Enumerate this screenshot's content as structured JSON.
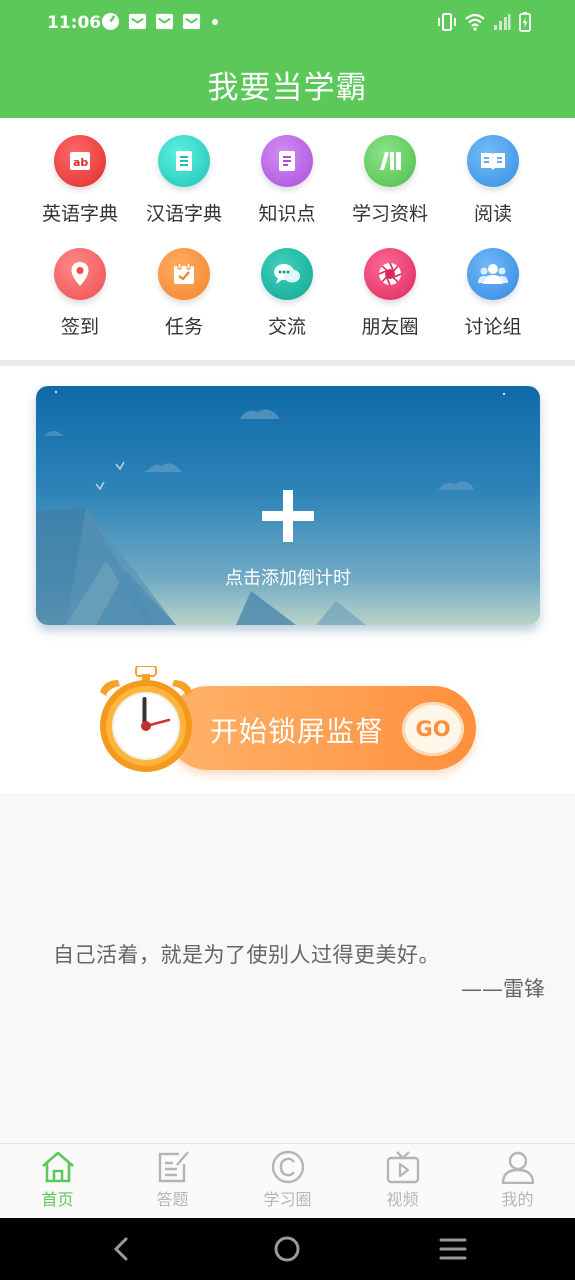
{
  "status_bar": {
    "time": "11:06",
    "left_icons": [
      "quick-settings-icon",
      "mail-icon",
      "mail-icon",
      "mail-icon",
      "notification-dot"
    ],
    "right_icons": [
      "vibrate-icon",
      "wifi-icon",
      "signal-icon",
      "battery-charging-icon"
    ]
  },
  "header": {
    "title": "我要当学霸",
    "bg_color": "#5cc85a"
  },
  "grid": {
    "items": [
      {
        "label": "英语字典",
        "icon": "english-dictionary-icon",
        "color": "#ee3b3b"
      },
      {
        "label": "汉语字典",
        "icon": "chinese-dictionary-icon",
        "color": "#27d1c5"
      },
      {
        "label": "知识点",
        "icon": "knowledge-icon",
        "color": "#b361e0"
      },
      {
        "label": "学习资料",
        "icon": "study-materials-icon",
        "color": "#5cc85a"
      },
      {
        "label": "阅读",
        "icon": "reading-icon",
        "color": "#3e9ee8"
      },
      {
        "label": "签到",
        "icon": "checkin-location-icon",
        "color": "#f25b5b"
      },
      {
        "label": "任务",
        "icon": "task-calendar-icon",
        "color": "#f68b2f"
      },
      {
        "label": "交流",
        "icon": "chat-icon",
        "color": "#16b3a0"
      },
      {
        "label": "朋友圈",
        "icon": "moments-icon",
        "color": "#e53a6e"
      },
      {
        "label": "讨论组",
        "icon": "discussion-group-icon",
        "color": "#3f97ea"
      }
    ]
  },
  "countdown": {
    "hint": "点击添加倒计时"
  },
  "lock_screen": {
    "label": "开始锁屏监督",
    "go_label": "GO"
  },
  "quote": {
    "text": "自己活着，就是为了使别人过得更美好。",
    "author": "——雷锋"
  },
  "bottom_nav": {
    "active_color": "#5cc85a",
    "items": [
      {
        "label": "首页",
        "icon": "home-icon",
        "active": true
      },
      {
        "label": "答题",
        "icon": "answer-edit-icon",
        "active": false
      },
      {
        "label": "学习圈",
        "icon": "copyright-circle-icon",
        "active": false
      },
      {
        "label": "视频",
        "icon": "video-tv-icon",
        "active": false
      },
      {
        "label": "我的",
        "icon": "profile-icon",
        "active": false
      }
    ]
  },
  "system_nav": [
    "back-icon",
    "home-circle-icon",
    "recents-menu-icon"
  ]
}
